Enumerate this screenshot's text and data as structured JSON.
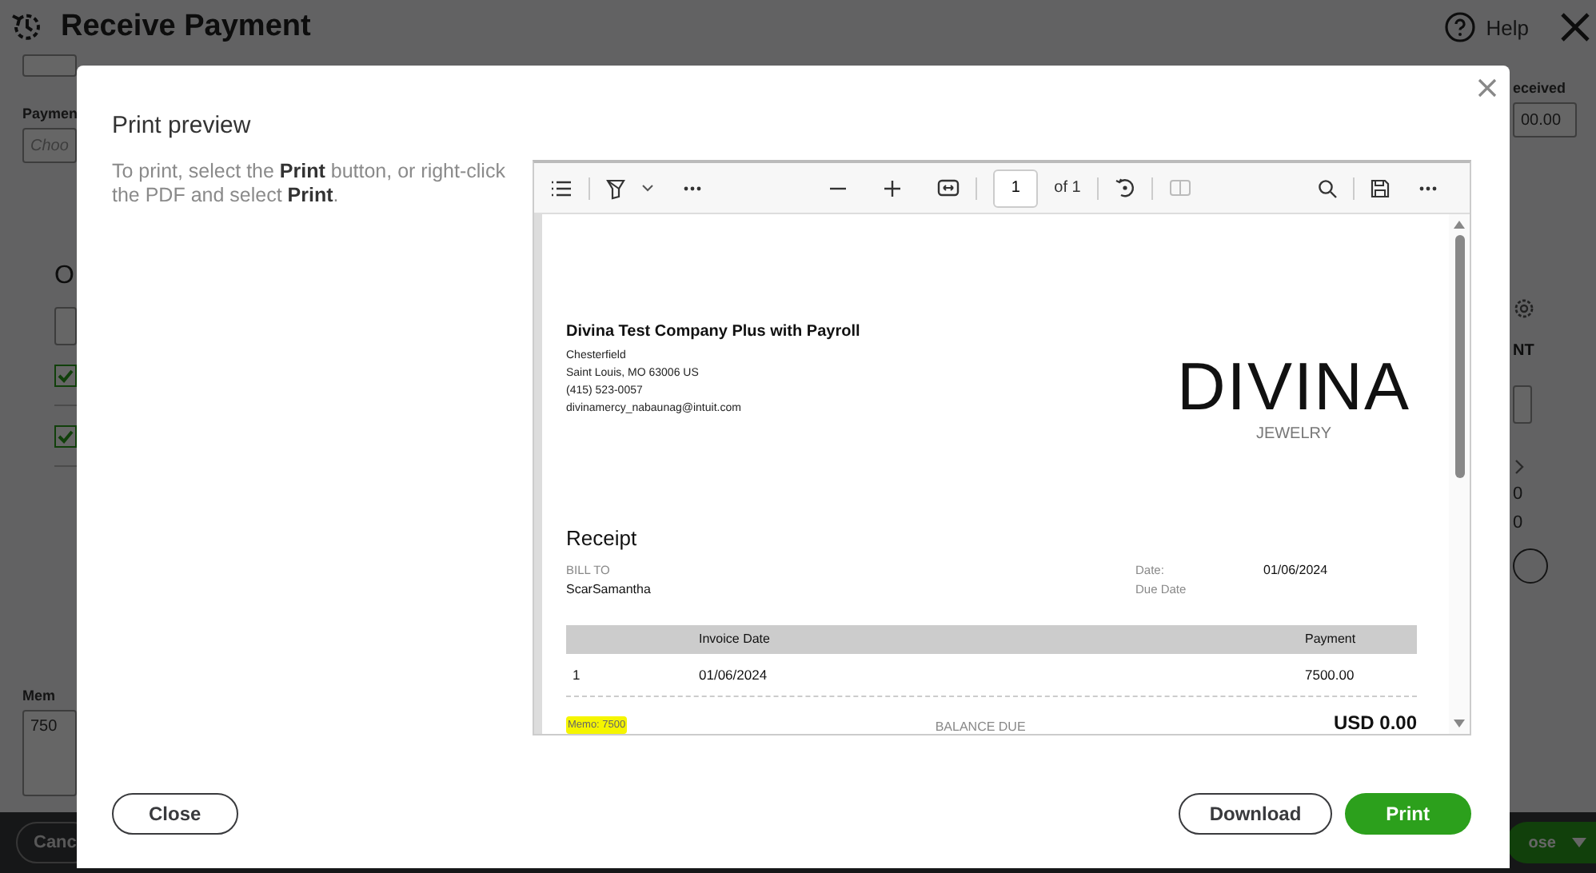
{
  "page": {
    "title": "Receive Payment",
    "help_label": "Help",
    "payment_label": "Paymen",
    "payment_placeholder": "Choo",
    "section_heading": "O",
    "rows": [
      {
        "checked": true
      },
      {
        "checked": true
      }
    ],
    "memo_label": "Mem",
    "memo_value": "750",
    "cancel_button": "Canc",
    "amount_label": "eceived",
    "amount_value": "00.00",
    "column_heading": "NT",
    "totals": [
      "0",
      "0"
    ],
    "save_button": "ose"
  },
  "modal": {
    "title": "Print preview",
    "instructions": "To print, select the **Print** button, or right-click the PDF and select **Print**.",
    "viewer": {
      "page_number": "1",
      "page_count": "of 1",
      "document": {
        "company_name": "Divina Test Company Plus with Payroll",
        "address_lines": [
          "Chesterfield",
          "Saint Louis, MO  63006 US",
          "(415) 523-0057",
          "divinamercy_nabaunag@intuit.com"
        ],
        "logo_name": "DIVINA",
        "logo_tagline": "JEWELRY",
        "title": "Receipt",
        "bill_to_label": "BILL TO",
        "customer": "ScarSamantha",
        "date_label": "Date:",
        "date_value": "01/06/2024",
        "due_date_label": "Due Date",
        "columns": [
          "",
          "Invoice Date",
          "Payment"
        ],
        "rows": [
          {
            "cells": [
              "1",
              "01/06/2024",
              "7500.00"
            ]
          }
        ],
        "memo": "Memo: 7500",
        "balance_label": "BALANCE DUE",
        "balance_value": "USD 0.00"
      }
    },
    "close_button": "Close",
    "right_buttons": [
      {
        "label": "Download",
        "kind": "secondary"
      },
      {
        "label": "Print",
        "kind": "primary"
      }
    ]
  }
}
